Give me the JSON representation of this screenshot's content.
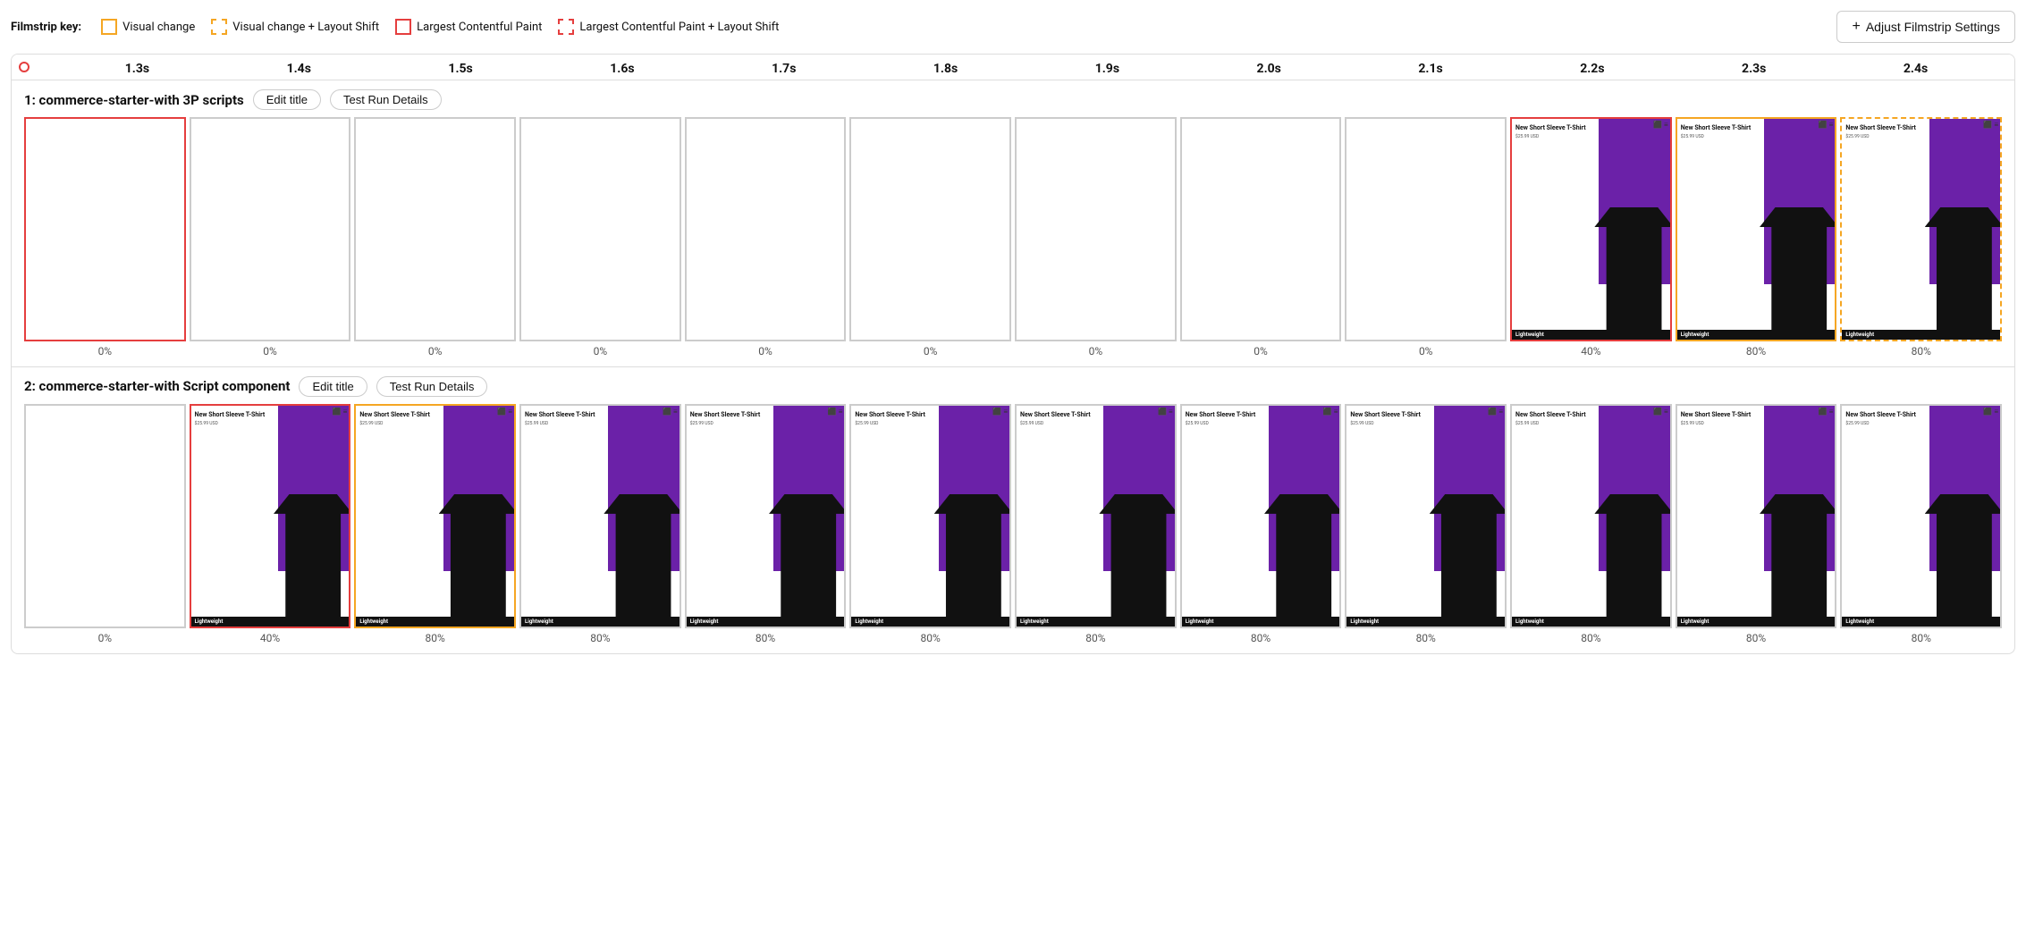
{
  "topBar": {
    "keyLabel": "Filmstrip key:",
    "items": [
      {
        "label": "Visual change",
        "type": "solid-yellow"
      },
      {
        "label": "Visual change + Layout Shift",
        "type": "dashed-yellow"
      },
      {
        "label": "Largest Contentful Paint",
        "type": "solid-red"
      },
      {
        "label": "Largest Contentful Paint + Layout Shift",
        "type": "dashed-red"
      }
    ],
    "adjustBtn": "Adjust Filmstrip Settings"
  },
  "timeline": {
    "ticks": [
      "1.3s",
      "1.4s",
      "1.5s",
      "1.6s",
      "1.7s",
      "1.8s",
      "1.9s",
      "2.0s",
      "2.1s",
      "2.2s",
      "2.3s",
      "2.4s"
    ]
  },
  "section1": {
    "title": "1: commerce-starter-with 3P scripts",
    "editLabel": "Edit title",
    "detailsLabel": "Test Run Details",
    "frames": [
      {
        "border": "red-solid",
        "hasContent": false,
        "percent": "0%"
      },
      {
        "border": "none",
        "hasContent": false,
        "percent": "0%"
      },
      {
        "border": "none",
        "hasContent": false,
        "percent": "0%"
      },
      {
        "border": "none",
        "hasContent": false,
        "percent": "0%"
      },
      {
        "border": "none",
        "hasContent": false,
        "percent": "0%"
      },
      {
        "border": "none",
        "hasContent": false,
        "percent": "0%"
      },
      {
        "border": "none",
        "hasContent": false,
        "percent": "0%"
      },
      {
        "border": "none",
        "hasContent": false,
        "percent": "0%"
      },
      {
        "border": "none",
        "hasContent": false,
        "percent": "0%"
      },
      {
        "border": "red-solid",
        "hasContent": true,
        "percent": "40%"
      },
      {
        "border": "yellow-solid",
        "hasContent": true,
        "percent": "80%"
      },
      {
        "border": "yellow-dashed",
        "hasContent": true,
        "percent": "80%"
      }
    ]
  },
  "section2": {
    "title": "2: commerce-starter-with Script component",
    "editLabel": "Edit title",
    "detailsLabel": "Test Run Details",
    "frames": [
      {
        "border": "none",
        "hasContent": false,
        "percent": "0%"
      },
      {
        "border": "red-solid",
        "hasContent": true,
        "percent": "40%"
      },
      {
        "border": "yellow-solid",
        "hasContent": true,
        "percent": "80%"
      },
      {
        "border": "none",
        "hasContent": true,
        "percent": "80%"
      },
      {
        "border": "none",
        "hasContent": true,
        "percent": "80%"
      },
      {
        "border": "none",
        "hasContent": true,
        "percent": "80%"
      },
      {
        "border": "none",
        "hasContent": true,
        "percent": "80%"
      },
      {
        "border": "none",
        "hasContent": true,
        "percent": "80%"
      },
      {
        "border": "none",
        "hasContent": true,
        "percent": "80%"
      },
      {
        "border": "none",
        "hasContent": true,
        "percent": "80%"
      },
      {
        "border": "none",
        "hasContent": true,
        "percent": "80%"
      },
      {
        "border": "none",
        "hasContent": true,
        "percent": "80%"
      }
    ]
  },
  "product": {
    "title": "New Short Sleeve T-Shirt",
    "price": "$25.99 USD",
    "bar": "Lightweight"
  }
}
